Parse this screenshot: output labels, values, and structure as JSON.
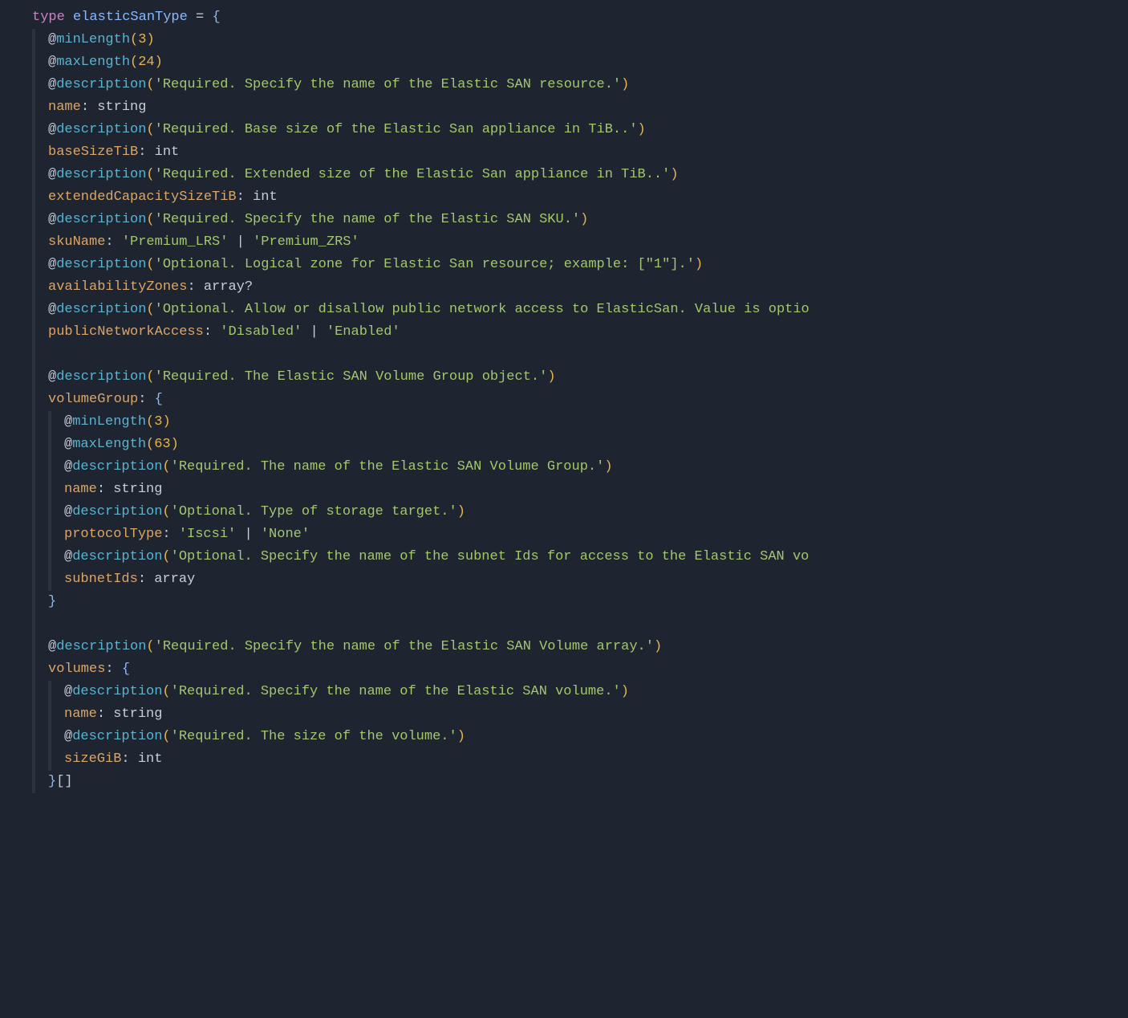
{
  "code": {
    "typeKeyword": "type",
    "typeName": "elasticSanType",
    "eq": "=",
    "openBrace": "{",
    "closeBrace": "}",
    "at": "@",
    "dec": {
      "minLength": "minLength",
      "maxLength": "maxLength",
      "description": "description"
    },
    "paren": {
      "open": "(",
      "close": ")"
    },
    "nums": {
      "three": "3",
      "twentyFour": "24",
      "sixtyThree": "63"
    },
    "strings": {
      "nameReq": "'Required. Specify the name of the Elastic SAN resource.'",
      "baseSize": "'Required. Base size of the Elastic San appliance in TiB..'",
      "extSize": "'Required. Extended size of the Elastic San appliance in TiB..'",
      "skuReq": "'Required. Specify the name of the Elastic SAN SKU.'",
      "premLRS": "'Premium_LRS'",
      "premZRS": "'Premium_ZRS'",
      "zoneOpt": "'Optional. Logical zone for Elastic San resource; example: [\"1\"].'",
      "pnaOpt": "'Optional. Allow or disallow public network access to ElasticSan. Value is optio",
      "disabled": "'Disabled'",
      "enabled": "'Enabled'",
      "vgReq": "'Required. The Elastic SAN Volume Group object.'",
      "vgNameReq": "'Required. The name of the Elastic SAN Volume Group.'",
      "protoOpt": "'Optional. Type of storage target.'",
      "iscsi": "'Iscsi'",
      "none": "'None'",
      "subnetOpt": "'Optional. Specify the name of the subnet Ids for access to the Elastic SAN vo",
      "volArrReq": "'Required. Specify the name of the Elastic SAN Volume array.'",
      "volNameReq": "'Required. Specify the name of the Elastic SAN volume.'",
      "volSizeReq": "'Required. The size of the volume.'"
    },
    "props": {
      "name": "name",
      "baseSizeTiB": "baseSizeTiB",
      "extendedCapacitySizeTiB": "extendedCapacitySizeTiB",
      "skuName": "skuName",
      "availabilityZones": "availabilityZones",
      "publicNetworkAccess": "publicNetworkAccess",
      "volumeGroup": "volumeGroup",
      "protocolType": "protocolType",
      "subnetIds": "subnetIds",
      "volumes": "volumes",
      "sizeGiB": "sizeGiB"
    },
    "types": {
      "string": "string",
      "int": "int",
      "array": "array"
    },
    "punc": {
      "colon": ":",
      "pipe": "|",
      "question": "?",
      "arraySuffix": "[]"
    }
  }
}
